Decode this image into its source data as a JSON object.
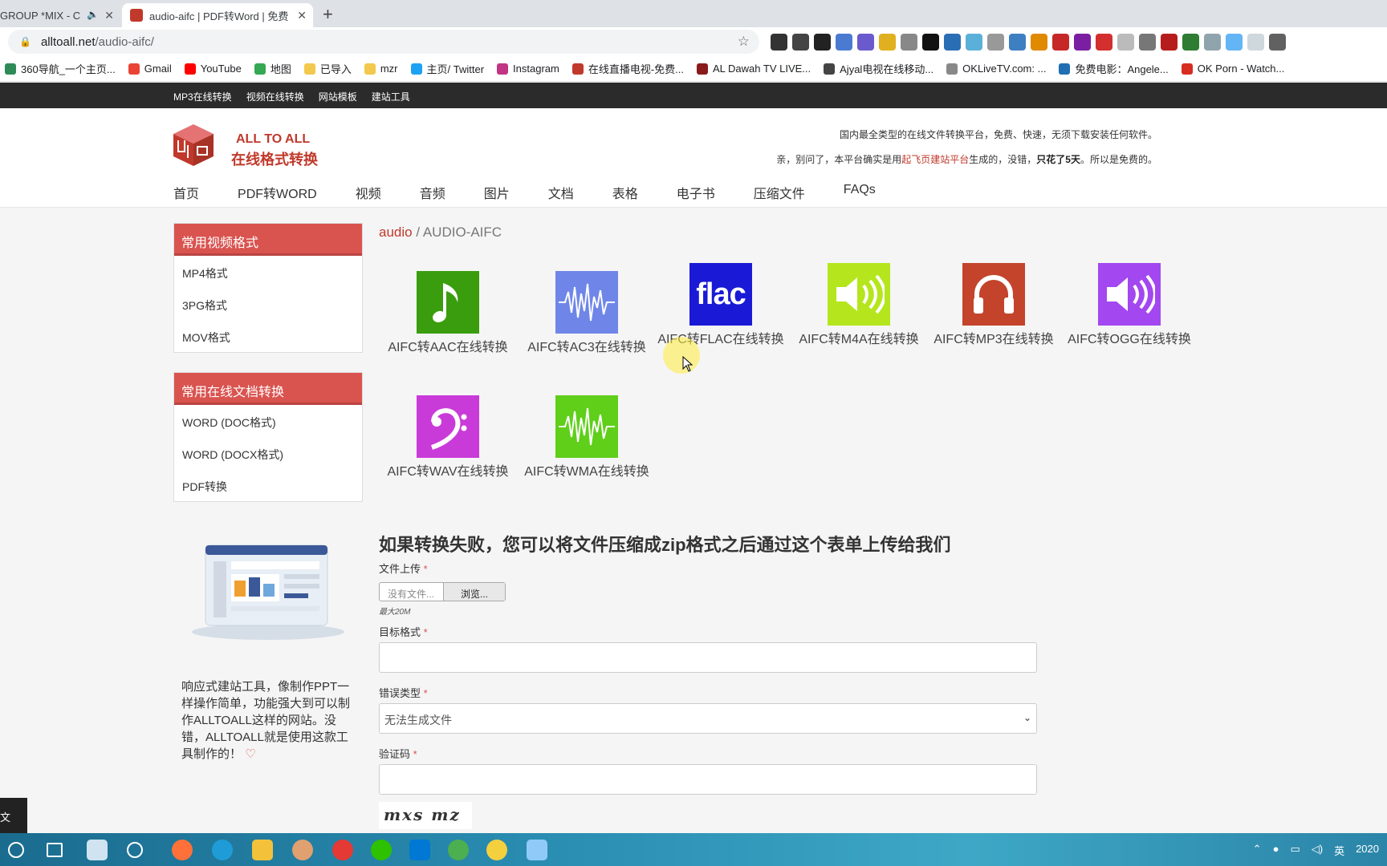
{
  "browser": {
    "tabs": [
      {
        "title": "GROUP *MIX - C",
        "active": false
      },
      {
        "title": "audio-aifc | PDF转Word | 免费",
        "active": true
      }
    ],
    "url_domain": "alltoall.net",
    "url_path": "/audio-aifc/",
    "bookmarks": [
      {
        "label": "360导航_一个主页...",
        "color": "#2e8b57"
      },
      {
        "label": "Gmail",
        "color": "#ea4335"
      },
      {
        "label": "YouTube",
        "color": "#ff0000"
      },
      {
        "label": "地图",
        "color": "#34a853"
      },
      {
        "label": "已导入",
        "color": "#f2c94c"
      },
      {
        "label": "mzr",
        "color": "#f2c94c"
      },
      {
        "label": "主页/ Twitter",
        "color": "#1da1f2"
      },
      {
        "label": "Instagram",
        "color": "#c13584"
      },
      {
        "label": "在线直播电视-免费...",
        "color": "#c0392b"
      },
      {
        "label": "AL Dawah TV LIVE...",
        "color": "#8b1a1a"
      },
      {
        "label": "Ajyal电视在线移动...",
        "color": "#444444"
      },
      {
        "label": "OKLiveTV.com: ...",
        "color": "#888888"
      },
      {
        "label": "免费电影：Angele...",
        "color": "#1f6fb2"
      },
      {
        "label": "OK Porn - Watch...",
        "color": "#d62d20"
      }
    ]
  },
  "site": {
    "top_links": [
      "MP3在线转换",
      "视频在线转换",
      "网站模板",
      "建站工具"
    ],
    "brand_line1": "ALL TO ALL",
    "brand_line2": "在线格式转换",
    "tagline1": "国内最全类型的在线文件转换平台，免费、快速，无须下载安装任何软件。",
    "tagline2_pre": "亲，别问了，本平台确实是用",
    "tagline2_hl": "起飞页建站平台",
    "tagline2_mid": "生成的，没错，",
    "tagline2_bold": "只花了5天",
    "tagline2_post": "。所以是免费的。",
    "nav": [
      "首页",
      "PDF转WORD",
      "视频",
      "音频",
      "图片",
      "文档",
      "表格",
      "电子书",
      "压缩文件",
      "FAQs"
    ]
  },
  "sidebar": {
    "video_title": "常用视频格式",
    "video_items": [
      "MP4格式",
      "3PG格式",
      "MOV格式"
    ],
    "doc_title": "常用在线文档转换",
    "doc_items": [
      "WORD (DOC格式)",
      "WORD (DOCX格式)",
      "PDF转换"
    ],
    "promo_text": "响应式建站工具，像制作PPT一样操作简单，功能强大到可以制作ALLTOALL这样的网站。没错，ALLTOALL就是使用这款工具制作的！"
  },
  "content": {
    "crumb_parent": "audio",
    "crumb_sep": " / ",
    "crumb_current": "AUDIO-AIFC",
    "formats": [
      {
        "label": "AIFC转AAC在线转换",
        "icon": "music-note-icon",
        "color": "#3a9d0e"
      },
      {
        "label": "AIFC转AC3在线转换",
        "icon": "waveform-icon",
        "color": "#6f86e8"
      },
      {
        "label": "AIFC转FLAC在线转换",
        "icon": "flac-icon",
        "color": "#1a1ad6",
        "text": "flac"
      },
      {
        "label": "AIFC转M4A在线转换",
        "icon": "speaker-icon",
        "color": "#b5e61d"
      },
      {
        "label": "AIFC转MP3在线转换",
        "icon": "headphones-icon",
        "color": "#c4432b"
      },
      {
        "label": "AIFC转OGG在线转换",
        "icon": "speaker-icon",
        "color": "#a347f0"
      },
      {
        "label": "AIFC转WAV在线转换",
        "icon": "bass-clef-icon",
        "color": "#c93bd8"
      },
      {
        "label": "AIFC转WMA在线转换",
        "icon": "waveform-icon",
        "color": "#5fcf1a"
      }
    ],
    "form": {
      "title": "如果转换失败，您可以将文件压缩成zip格式之后通过这个表单上传给我们",
      "upload_label": "文件上传",
      "file_placeholder": "没有文件...",
      "browse_label": "浏览...",
      "max_size": "最大20M",
      "target_label": "目标格式",
      "error_label": "错误类型",
      "error_value": "无法生成文件",
      "captcha_label": "验证码",
      "captcha_text": "mxs mz",
      "required_mark": "*"
    }
  },
  "left_widget_text": "文",
  "tray": {
    "ime": "英",
    "year": "2020"
  }
}
